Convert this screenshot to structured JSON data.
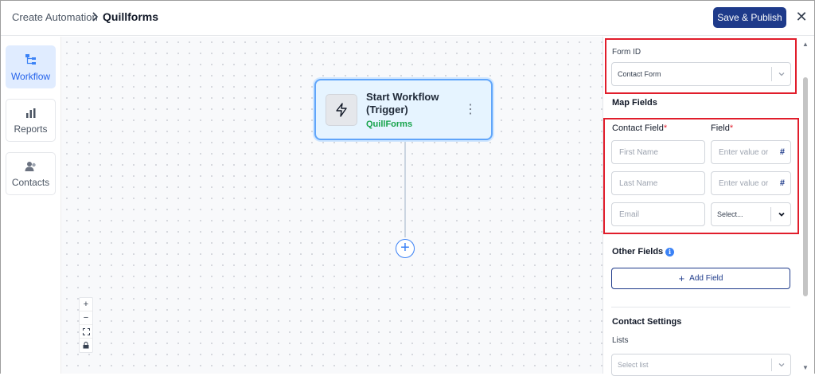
{
  "header": {
    "breadcrumb_parent": "Create Automation",
    "breadcrumb_separator": "chevron-right-icon",
    "breadcrumb_current": "Quillforms",
    "publish_label": "Save & Publish",
    "close_icon": "close-icon"
  },
  "sidebar": {
    "items": [
      {
        "label": "Workflow",
        "icon": "workflow-icon",
        "active": true
      },
      {
        "label": "Reports",
        "icon": "bar-chart-icon",
        "active": false
      },
      {
        "label": "Contacts",
        "icon": "contacts-icon",
        "active": false
      }
    ]
  },
  "canvas": {
    "node": {
      "title": "Start Workflow (Trigger)",
      "subtitle": "QuillForms",
      "icon": "lightning-icon",
      "menu_icon": "kebab-menu-icon"
    },
    "add_step_icon": "plus-circle-icon",
    "zoom_controls": [
      "zoom-in-icon",
      "zoom-out-icon",
      "fit-view-icon",
      "lock-icon"
    ]
  },
  "panel": {
    "form_id": {
      "label": "Form ID",
      "value": "Contact Form"
    },
    "map_fields": {
      "title": "Map Fields",
      "contact_field_header": "Contact Field",
      "field_header": "Field",
      "required_mark": "*",
      "rows": [
        {
          "contact_placeholder": "First Name",
          "field_placeholder": "Enter value or",
          "field_type": "input"
        },
        {
          "contact_placeholder": "Last Name",
          "field_placeholder": "Enter value or",
          "field_type": "input"
        },
        {
          "contact_placeholder": "Email",
          "field_placeholder": "Select...",
          "field_type": "select"
        }
      ],
      "hash_symbol": "#"
    },
    "other_fields": {
      "title": "Other Fields",
      "info_symbol": "i",
      "add_label": "Add Field",
      "add_symbol": "+"
    },
    "contact_settings": {
      "title": "Contact Settings",
      "lists_label": "Lists",
      "lists_placeholder": "Select list"
    }
  },
  "colors": {
    "primary": "#1e3a8a",
    "highlight": "#e11d2b",
    "node_border": "#60a5fa",
    "node_bg": "#e6f4ff",
    "trigger_source": "#16a34a"
  }
}
